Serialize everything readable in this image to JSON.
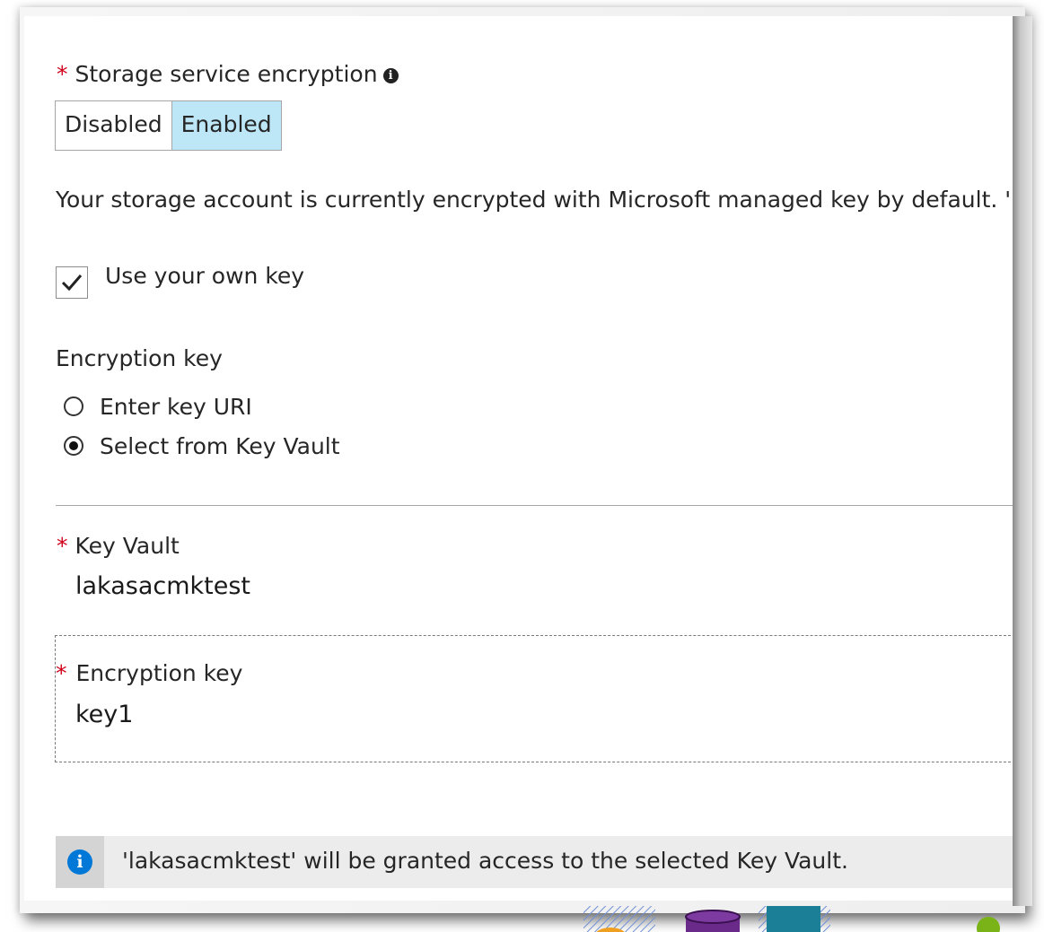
{
  "encryption": {
    "label": "Storage service encryption",
    "required_mark": "*",
    "info_icon": "info-icon",
    "options": [
      "Disabled",
      "Enabled"
    ],
    "selected": "Enabled"
  },
  "description": "Your storage account is currently encrypted with Microsoft managed key by default. '",
  "own_key": {
    "label": "Use your own key",
    "checked": true
  },
  "encryption_key_source": {
    "label": "Encryption key",
    "options": [
      {
        "label": "Enter key URI",
        "selected": false
      },
      {
        "label": "Select from Key Vault",
        "selected": true
      }
    ]
  },
  "key_vault": {
    "label": "Key Vault",
    "required_mark": "*",
    "value": "lakasacmktest"
  },
  "encryption_key": {
    "label": "Encryption key",
    "required_mark": "*",
    "value": "key1"
  },
  "info_message": {
    "icon": "info-icon",
    "text": "'lakasacmktest' will be granted access to the selected Key Vault."
  },
  "colors": {
    "required": "#d0021b",
    "toggle_selected": "#bde7f7",
    "info_blue": "#0078d7",
    "info_bar_bg": "#ececec"
  }
}
